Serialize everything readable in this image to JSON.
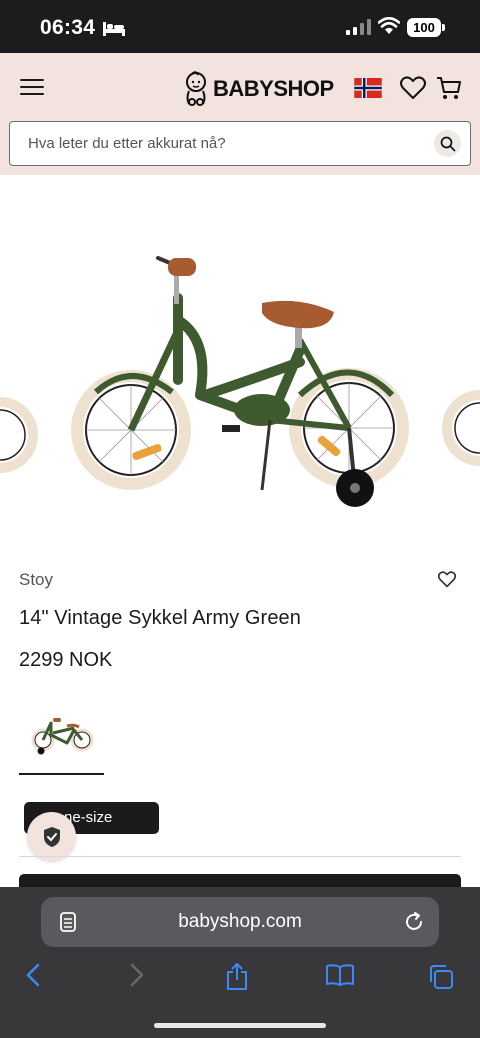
{
  "status_bar": {
    "time": "06:34",
    "battery": "100"
  },
  "header": {
    "logo_text": "BABYSHOP",
    "search_placeholder": "Hva leter du etter akkurat nå?"
  },
  "product": {
    "brand": "Stoy",
    "title": "14\" Vintage Sykkel Army Green",
    "price": "2299 NOK",
    "size_option": "One-size",
    "size_chip_visible": "ne-size",
    "color": "#3f5a2e"
  },
  "browser": {
    "url": "babyshop.com"
  },
  "colors": {
    "header_bg": "#f2e3df",
    "status_bg": "#1c1c1e",
    "browser_bg": "#38383a",
    "accent_blue": "#3b8af7"
  }
}
